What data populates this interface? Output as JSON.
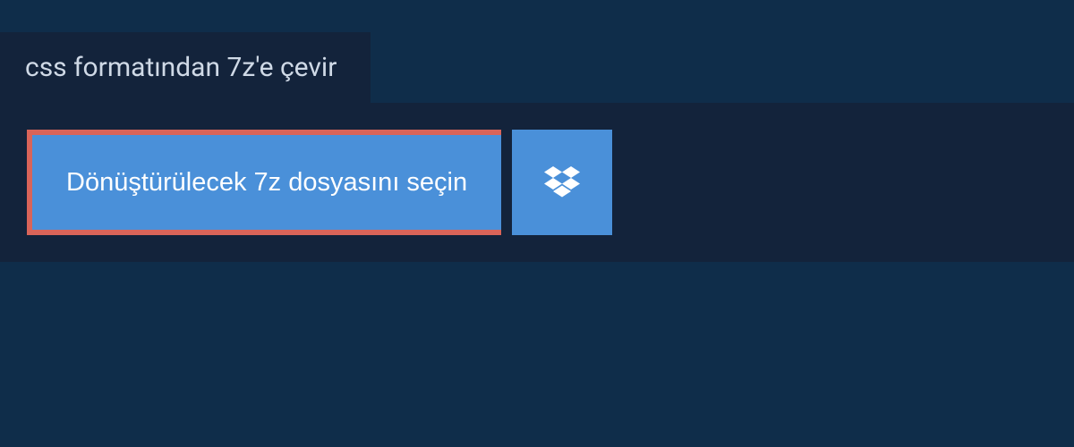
{
  "header": {
    "title": "css formatından 7z'e çevir"
  },
  "upload": {
    "select_file_label": "Dönüştürülecek 7z dosyasını seçin",
    "dropbox_icon_name": "dropbox-icon"
  },
  "colors": {
    "background": "#0f2d4a",
    "panel": "#13233b",
    "button": "#4a90d9",
    "button_border": "#d96459",
    "text_light": "#cfd9e6",
    "text_white": "#ffffff"
  }
}
